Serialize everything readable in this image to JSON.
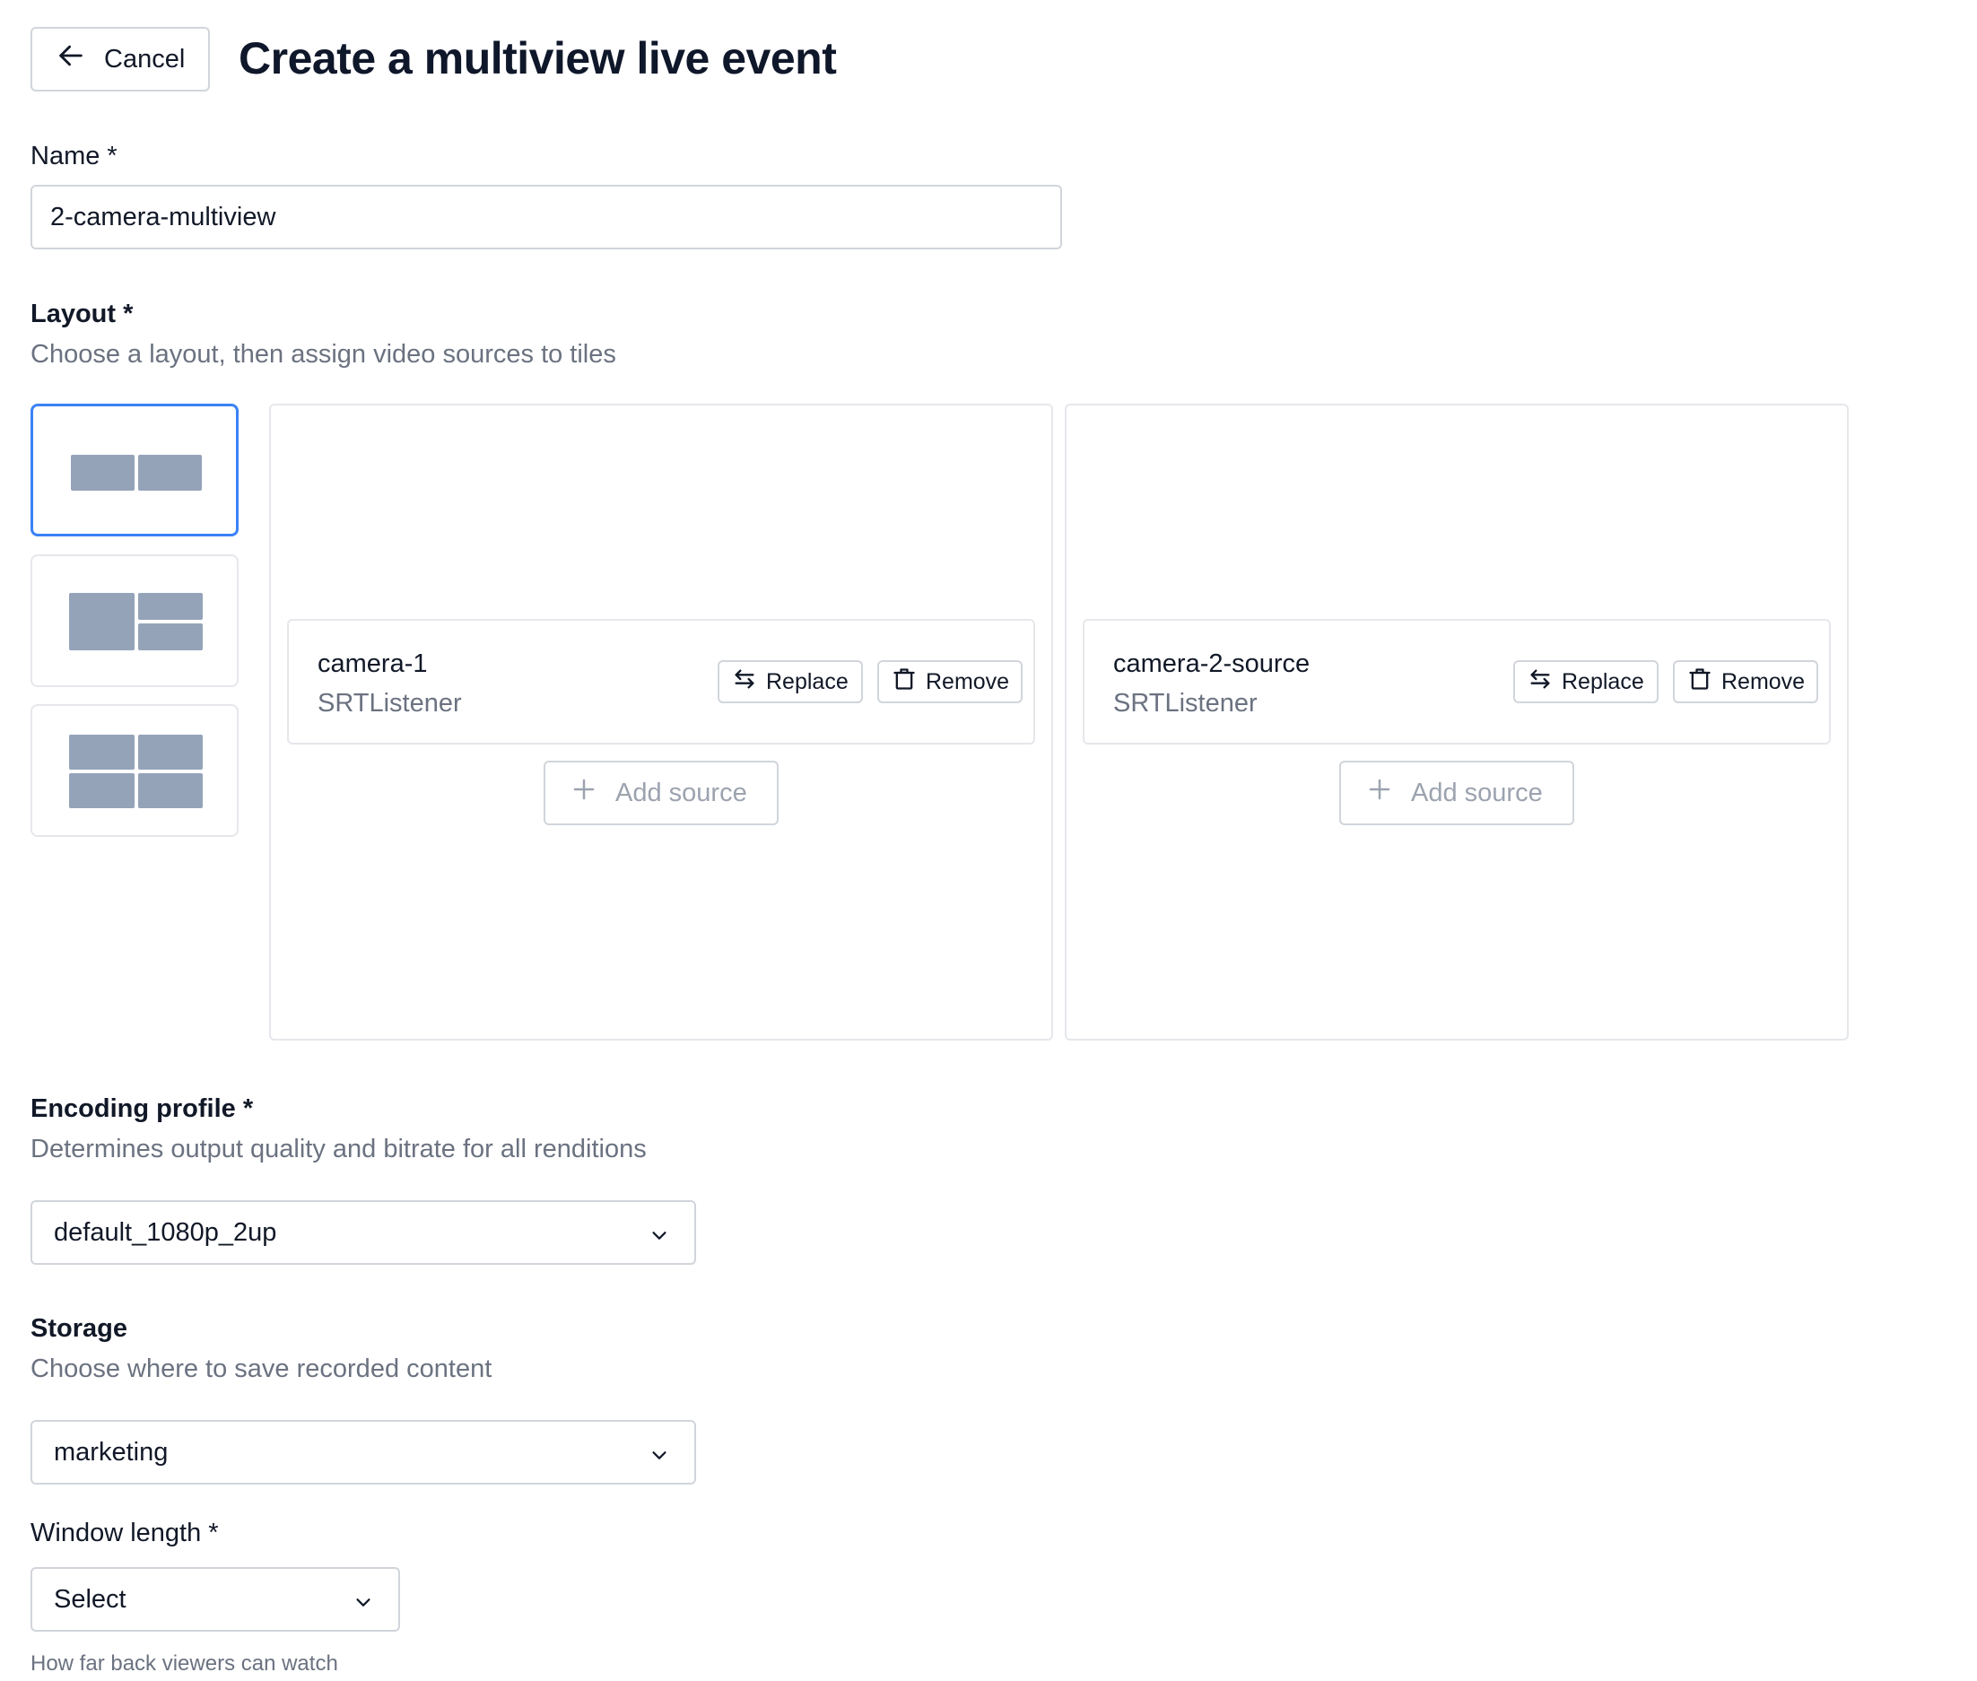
{
  "header": {
    "cancel_label": "Cancel",
    "title": "Create a multiview live event"
  },
  "name_field": {
    "label": "Name *",
    "value": "2-camera-multiview"
  },
  "layout": {
    "label": "Layout *",
    "hint": "Choose a layout, then assign video sources to tiles",
    "options": [
      "2-up side by side",
      "1 large + 2 stacked",
      "2x2 grid"
    ],
    "selected_index": 0,
    "tiles": [
      {
        "source_name": "camera-1",
        "source_type": "SRTListener",
        "replace_label": "Replace",
        "remove_label": "Remove",
        "add_source_label": "Add source"
      },
      {
        "source_name": "camera-2-source",
        "source_type": "SRTListener",
        "replace_label": "Replace",
        "remove_label": "Remove",
        "add_source_label": "Add source"
      }
    ]
  },
  "encoding_profile": {
    "label": "Encoding profile *",
    "hint": "Determines output quality and bitrate for all renditions",
    "value": "default_1080p_2up"
  },
  "storage": {
    "label": "Storage",
    "hint": "Choose where to save recorded content",
    "value": "marketing"
  },
  "window_length": {
    "label": "Window length *",
    "value": "Select",
    "hint": "How far back viewers can watch"
  },
  "colors": {
    "accent": "#3b82f6",
    "thumb_block": "#94a3b8",
    "muted_text": "#6b7280",
    "border": "#d1d5db"
  },
  "icons": {
    "cancel": "arrow-left-icon",
    "replace": "swap-arrows-icon",
    "remove": "trash-icon",
    "add": "plus-icon",
    "select": "chevron-down-icon"
  }
}
